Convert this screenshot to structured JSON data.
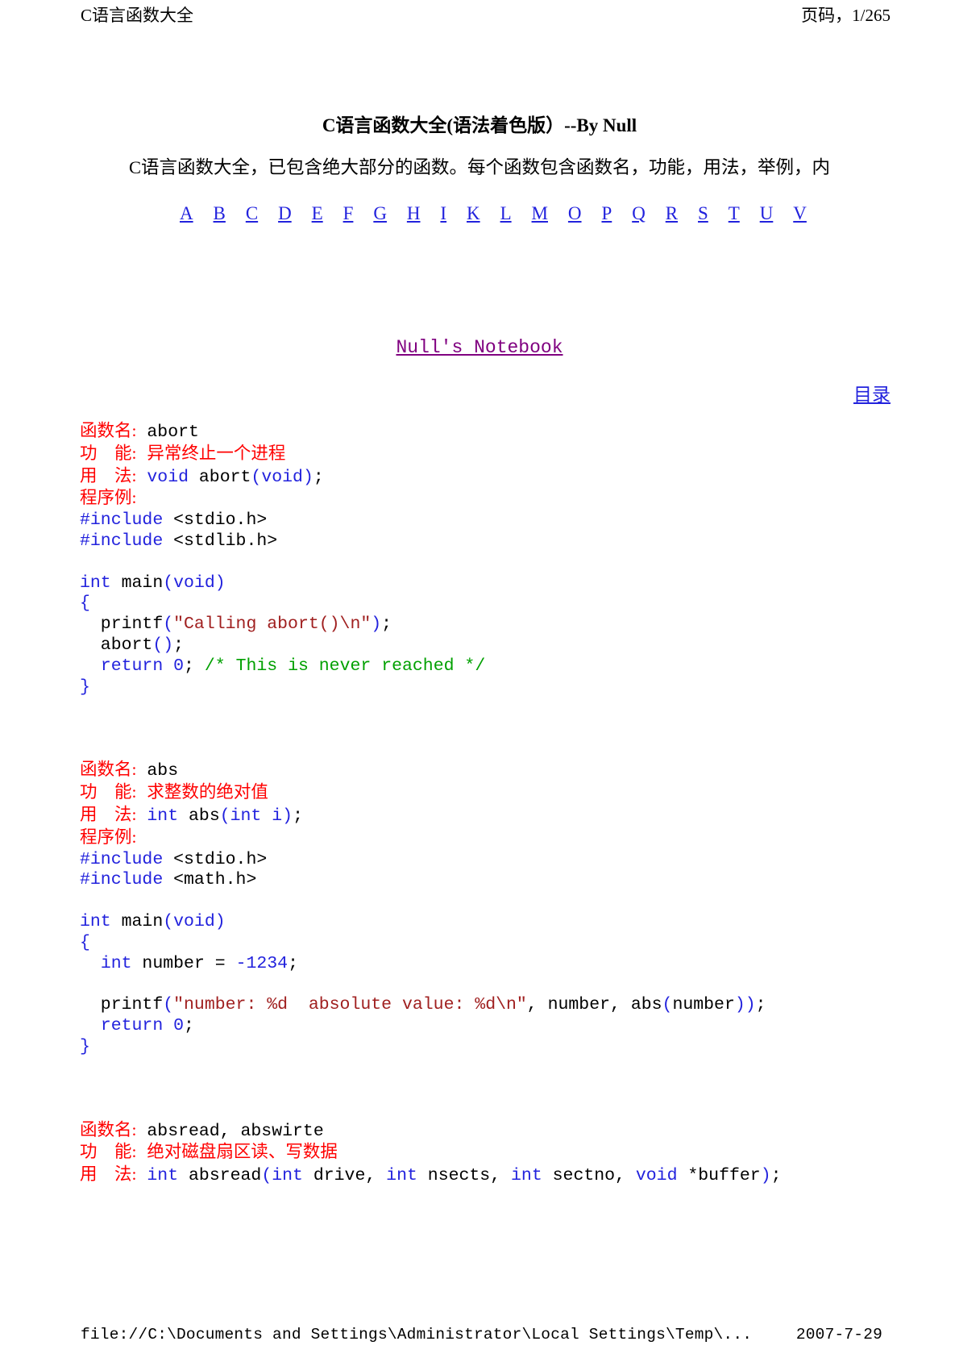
{
  "header": {
    "left_title": "C语言函数大全",
    "right_page": "页码，1/265"
  },
  "footer": {
    "path": "file://C:\\Documents and Settings\\Administrator\\Local Settings\\Temp\\...",
    "date": "2007-7-29"
  },
  "title": "C语言函数大全(语法着色版）--By Null",
  "description": "C语言函数大全，已包含绝大部分的函数。每个函数包含函数名，功能，用法，举例，内",
  "alpha_index": [
    "A",
    "B",
    "C",
    "D",
    "E",
    "F",
    "G",
    "H",
    "I",
    "K",
    "L",
    "M",
    "O",
    "P",
    "Q",
    "R",
    "S",
    "T",
    "U",
    "V"
  ],
  "notebook_link": "Null's Notebook",
  "toc_link": "目录",
  "labels": {
    "name": "函数名:",
    "func": "功　能:",
    "usage": "用　法:",
    "example": "程序例:"
  },
  "colors": {
    "label_red": "#ff0000",
    "keyword_blue": "#2222dd",
    "string_darkred": "#a02020",
    "comment_green": "#00a000",
    "link_blue": "#2222dd",
    "link_purple": "#800080",
    "text_black": "#000000"
  },
  "entries": [
    {
      "name": "abort",
      "function": "异常终止一个进程",
      "usage_kw1": "void",
      "usage_mid": " abort",
      "usage_paren_open": "(",
      "usage_kw2": "void",
      "usage_paren_close": ")",
      "usage_semi": ";",
      "code": [
        {
          "parts": [
            {
              "t": "#include ",
              "c": "kw"
            },
            {
              "t": "<stdio.h>",
              "c": "id"
            }
          ]
        },
        {
          "parts": [
            {
              "t": "#include ",
              "c": "kw"
            },
            {
              "t": "<stdlib.h>",
              "c": "id"
            }
          ]
        },
        {
          "parts": []
        },
        {
          "parts": [
            {
              "t": "int",
              "c": "kw"
            },
            {
              "t": " main",
              "c": "id"
            },
            {
              "t": "(",
              "c": "kw"
            },
            {
              "t": "void",
              "c": "kw"
            },
            {
              "t": ")",
              "c": "kw"
            }
          ]
        },
        {
          "parts": [
            {
              "t": "{",
              "c": "kw"
            }
          ]
        },
        {
          "parts": [
            {
              "t": "  printf",
              "c": "id"
            },
            {
              "t": "(",
              "c": "kw"
            },
            {
              "t": "\"Calling abort()\\n\"",
              "c": "str"
            },
            {
              "t": ")",
              "c": "kw"
            },
            {
              "t": ";",
              "c": "id"
            }
          ]
        },
        {
          "parts": [
            {
              "t": "  abort",
              "c": "id"
            },
            {
              "t": "()",
              "c": "kw"
            },
            {
              "t": ";",
              "c": "id"
            }
          ]
        },
        {
          "parts": [
            {
              "t": "  ",
              "c": "id"
            },
            {
              "t": "return",
              "c": "kw"
            },
            {
              "t": " ",
              "c": "id"
            },
            {
              "t": "0",
              "c": "kw"
            },
            {
              "t": "; ",
              "c": "id"
            },
            {
              "t": "/* This is never reached */",
              "c": "com"
            }
          ]
        },
        {
          "parts": [
            {
              "t": "}",
              "c": "kw"
            }
          ]
        }
      ]
    },
    {
      "name": "abs",
      "function": "求整数的绝对值",
      "usage_kw1": "int",
      "usage_mid": " abs",
      "usage_paren_open": "(",
      "usage_kw2": "int",
      "usage_paren_close": " i)",
      "usage_semi": ";",
      "code": [
        {
          "parts": [
            {
              "t": "#include ",
              "c": "kw"
            },
            {
              "t": "<stdio.h>",
              "c": "id"
            }
          ]
        },
        {
          "parts": [
            {
              "t": "#include ",
              "c": "kw"
            },
            {
              "t": "<math.h>",
              "c": "id"
            }
          ]
        },
        {
          "parts": []
        },
        {
          "parts": [
            {
              "t": "int",
              "c": "kw"
            },
            {
              "t": " main",
              "c": "id"
            },
            {
              "t": "(",
              "c": "kw"
            },
            {
              "t": "void",
              "c": "kw"
            },
            {
              "t": ")",
              "c": "kw"
            }
          ]
        },
        {
          "parts": [
            {
              "t": "{",
              "c": "kw"
            }
          ]
        },
        {
          "parts": [
            {
              "t": "  ",
              "c": "id"
            },
            {
              "t": "int",
              "c": "kw"
            },
            {
              "t": " number = ",
              "c": "id"
            },
            {
              "t": "-1234",
              "c": "kw"
            },
            {
              "t": ";",
              "c": "id"
            }
          ]
        },
        {
          "parts": []
        },
        {
          "parts": [
            {
              "t": "  printf",
              "c": "id"
            },
            {
              "t": "(",
              "c": "kw"
            },
            {
              "t": "\"number: %d  absolute value: %d\\n\"",
              "c": "str"
            },
            {
              "t": ", number, abs",
              "c": "id"
            },
            {
              "t": "(",
              "c": "kw"
            },
            {
              "t": "number",
              "c": "id"
            },
            {
              "t": "))",
              "c": "kw"
            },
            {
              "t": ";",
              "c": "id"
            }
          ]
        },
        {
          "parts": [
            {
              "t": "  ",
              "c": "id"
            },
            {
              "t": "return",
              "c": "kw"
            },
            {
              "t": " ",
              "c": "id"
            },
            {
              "t": "0",
              "c": "kw"
            },
            {
              "t": ";",
              "c": "id"
            }
          ]
        },
        {
          "parts": [
            {
              "t": "}",
              "c": "kw"
            }
          ]
        }
      ]
    },
    {
      "name": "absread, abswirte",
      "function": "绝对磁盘扇区读、写数据",
      "usage_kw1": "int",
      "usage_mid": " absread",
      "usage_paren_open": "(",
      "usage_kw2": "int",
      "usage_paren_close": " drive, int nsects, int sectno, void *buffer)",
      "usage_semi": ";",
      "usage_rich": [
        {
          "t": "int",
          "c": "kw"
        },
        {
          "t": " absread",
          "c": "id"
        },
        {
          "t": "(",
          "c": "kw"
        },
        {
          "t": "int",
          "c": "kw"
        },
        {
          "t": " drive, ",
          "c": "id"
        },
        {
          "t": "int",
          "c": "kw"
        },
        {
          "t": " nsects, ",
          "c": "id"
        },
        {
          "t": "int",
          "c": "kw"
        },
        {
          "t": " sectno, ",
          "c": "id"
        },
        {
          "t": "void",
          "c": "kw"
        },
        {
          "t": " *buffer",
          "c": "id"
        },
        {
          "t": ")",
          "c": "kw"
        },
        {
          "t": ";",
          "c": "id"
        }
      ],
      "code": []
    }
  ]
}
